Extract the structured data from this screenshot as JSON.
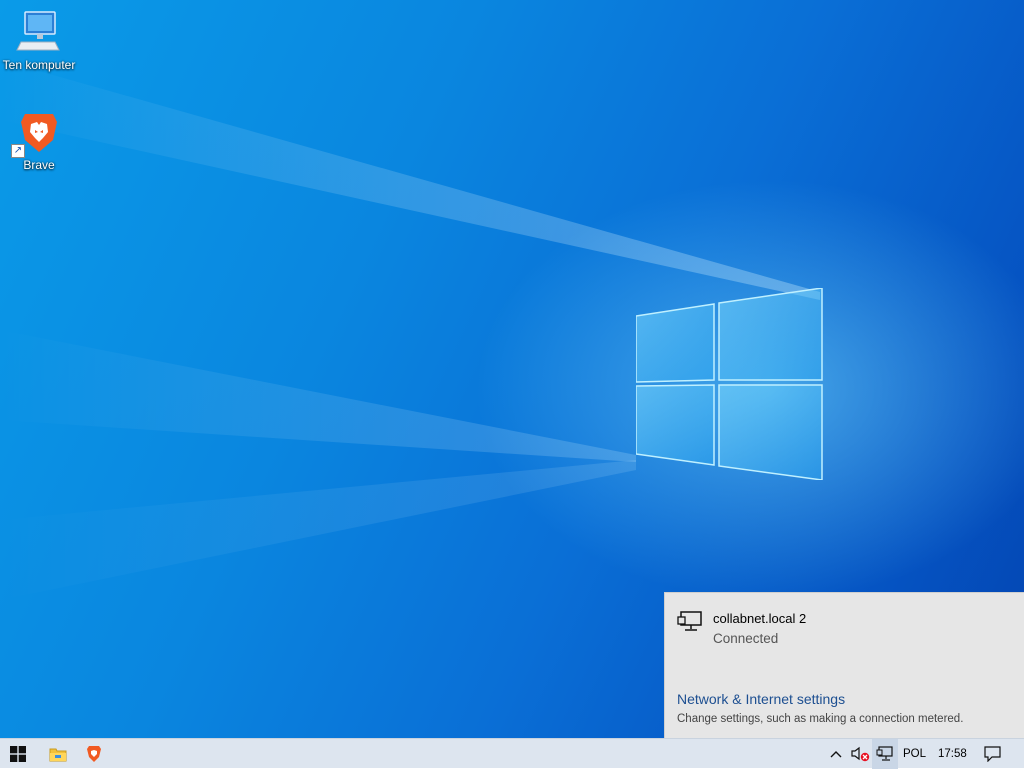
{
  "desktop": {
    "icons": [
      {
        "label": "Ten komputer",
        "icon": "computer-icon"
      },
      {
        "label": "Brave",
        "icon": "brave-lion-icon"
      }
    ]
  },
  "network_flyout": {
    "network_name": "collabnet.local 2",
    "status": "Connected",
    "settings_link": "Network & Internet settings",
    "settings_description": "Change settings, such as making a connection metered.",
    "icon": "wired-network-icon"
  },
  "taskbar": {
    "pinned": [
      "windows-start-icon",
      "file-explorer-icon",
      "brave-icon"
    ],
    "tray": {
      "chevron_icon": "chevron-up-icon",
      "volume_icon": "volume-muted-icon",
      "network_icon": "wired-network-icon",
      "language": "POL",
      "time": "17:58",
      "notification_icon": "action-center-icon"
    }
  },
  "colors": {
    "desktop_blue": "#0a86df",
    "link_blue": "#1d4f91",
    "flyout_bg": "#e6e6e6",
    "taskbar_bg": "#dde5ef"
  }
}
